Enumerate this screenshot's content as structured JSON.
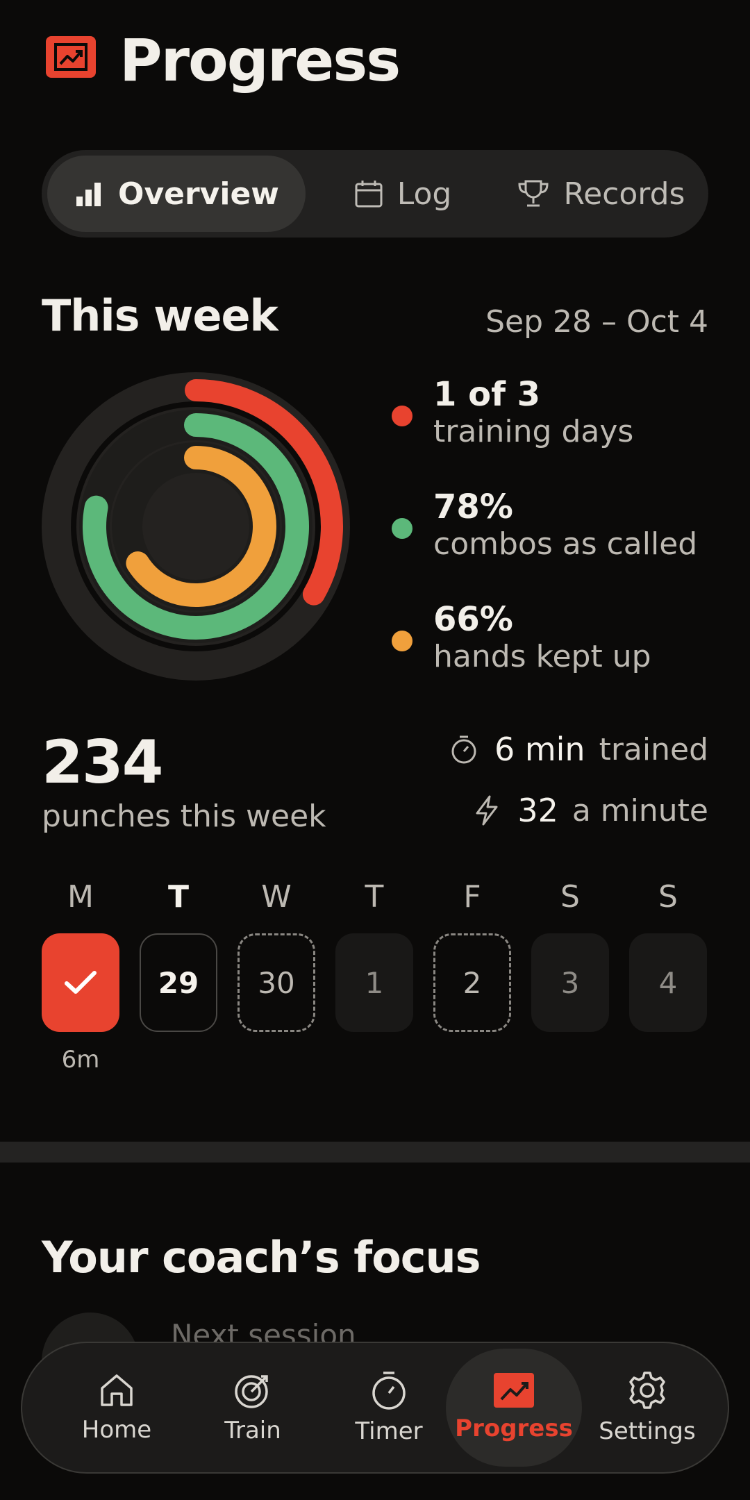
{
  "header": {
    "title": "Progress",
    "icon": "chart-trending-icon"
  },
  "tabs": [
    {
      "label": "Overview",
      "icon": "bar-chart-icon",
      "active": true
    },
    {
      "label": "Log",
      "icon": "calendar-icon",
      "active": false
    },
    {
      "label": "Records",
      "icon": "trophy-icon",
      "active": false
    }
  ],
  "week": {
    "title": "This week",
    "range": "Sep 28 – Oct 4",
    "rings": [
      {
        "value": "1 of 3",
        "label": "training days",
        "color": "#e8432f",
        "fraction": 0.333
      },
      {
        "value": "78%",
        "label": "combos as called",
        "color": "#5cb87a",
        "fraction": 0.78
      },
      {
        "value": "66%",
        "label": "hands kept up",
        "color": "#f0a03c",
        "fraction": 0.66
      }
    ],
    "punches": {
      "value": "234",
      "label": "punches this week"
    },
    "stats": [
      {
        "icon": "stopwatch-icon",
        "value": "6 min",
        "label": "trained"
      },
      {
        "icon": "bolt-icon",
        "value": "32",
        "label": "a minute"
      }
    ],
    "days": [
      {
        "letter": "M",
        "day": "",
        "status": "done",
        "duration": "6m"
      },
      {
        "letter": "T",
        "day": "29",
        "status": "today"
      },
      {
        "letter": "W",
        "day": "30",
        "status": "planned"
      },
      {
        "letter": "T",
        "day": "1",
        "status": "rest"
      },
      {
        "letter": "F",
        "day": "2",
        "status": "planned"
      },
      {
        "letter": "S",
        "day": "3",
        "status": "rest"
      },
      {
        "letter": "S",
        "day": "4",
        "status": "rest"
      }
    ]
  },
  "coach": {
    "title": "Your coach’s focus",
    "next_label": "Next session"
  },
  "nav": [
    {
      "label": "Home",
      "icon": "home-icon",
      "active": false
    },
    {
      "label": "Train",
      "icon": "target-icon",
      "active": false
    },
    {
      "label": "Timer",
      "icon": "stopwatch-icon",
      "active": false
    },
    {
      "label": "Progress",
      "icon": "chart-trending-icon",
      "active": true
    },
    {
      "label": "Settings",
      "icon": "gear-icon",
      "active": false
    }
  ],
  "colors": {
    "accent": "#e8432f",
    "green": "#5cb87a",
    "orange": "#f0a03c",
    "background": "#0b0a09"
  }
}
